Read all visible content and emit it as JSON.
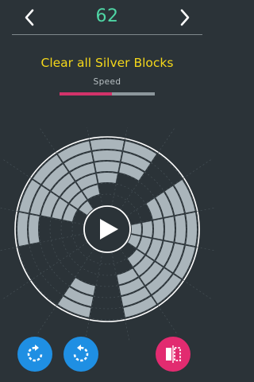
{
  "header": {
    "level": "62"
  },
  "objective": "Clear all Silver Blocks",
  "speed": {
    "label": "Speed",
    "value": 0.55
  },
  "colors": {
    "background": "#2b3338",
    "level": "#4fd6a5",
    "objective": "#f4d71a",
    "speed_fill": "#d2336a",
    "speed_track": "#8c979c",
    "block": "#aab5bb",
    "rotate_button": "#1f8fe3",
    "mirror_button": "#e22b70"
  },
  "board": {
    "rings": 6,
    "sectors": 16,
    "blocks": [
      [
        0,
        3
      ],
      [
        0,
        4
      ],
      [
        0,
        5
      ],
      [
        2,
        2
      ],
      [
        2,
        3
      ],
      [
        2,
        4
      ],
      [
        2,
        5
      ],
      [
        3,
        0
      ],
      [
        3,
        1
      ],
      [
        3,
        2
      ],
      [
        3,
        3
      ],
      [
        3,
        4
      ],
      [
        3,
        5
      ],
      [
        4,
        0
      ],
      [
        4,
        1
      ],
      [
        4,
        2
      ],
      [
        4,
        3
      ],
      [
        4,
        4
      ],
      [
        4,
        5
      ],
      [
        5,
        1
      ],
      [
        5,
        2
      ],
      [
        5,
        3
      ],
      [
        5,
        4
      ],
      [
        5,
        5
      ],
      [
        6,
        2
      ],
      [
        6,
        3
      ],
      [
        6,
        4
      ],
      [
        6,
        5
      ],
      [
        8,
        3
      ],
      [
        8,
        4
      ],
      [
        8,
        5
      ],
      [
        11,
        4
      ],
      [
        11,
        5
      ],
      [
        12,
        1
      ],
      [
        12,
        2
      ],
      [
        12,
        3
      ],
      [
        12,
        4
      ],
      [
        12,
        5
      ],
      [
        13,
        0
      ],
      [
        13,
        1
      ],
      [
        13,
        2
      ],
      [
        13,
        3
      ],
      [
        13,
        4
      ],
      [
        13,
        5
      ],
      [
        14,
        1
      ],
      [
        14,
        2
      ],
      [
        14,
        3
      ],
      [
        14,
        4
      ],
      [
        14,
        5
      ],
      [
        15,
        2
      ],
      [
        15,
        3
      ],
      [
        15,
        4
      ],
      [
        15,
        5
      ]
    ]
  },
  "controls": {
    "prev_icon": "chevron-left-icon",
    "next_icon": "chevron-right-icon",
    "play_icon": "play-icon",
    "rotate_left_icon": "rotate-left-icon",
    "rotate_right_icon": "rotate-right-icon",
    "mirror_icon": "mirror-icon"
  }
}
